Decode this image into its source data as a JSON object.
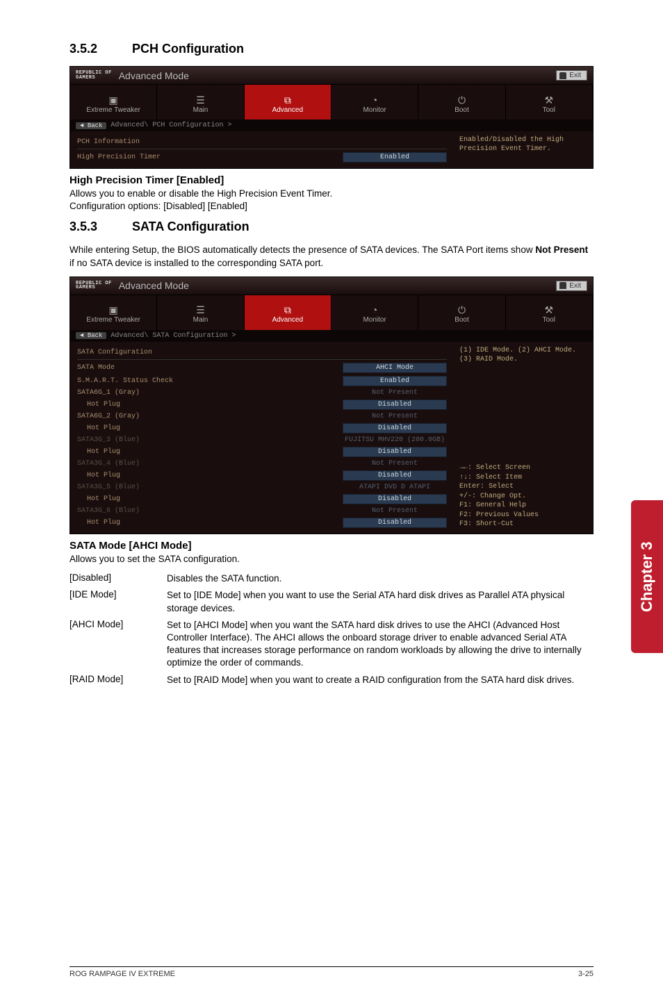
{
  "section_352": {
    "num": "3.5.2",
    "title": "PCH Configuration"
  },
  "bios1": {
    "brand_top": "REPUBLIC OF",
    "brand_bottom": "GAMERS",
    "mode": "Advanced Mode",
    "exit": "Exit",
    "tabs": [
      "Extreme Tweaker",
      "Main",
      "Advanced",
      "Monitor",
      "Boot",
      "Tool"
    ],
    "back": "Back",
    "breadcrumb": "Advanced\\ PCH Configuration >",
    "info_label": "PCH Information",
    "row_label": "High Precision Timer",
    "row_value": "Enabled",
    "help": "Enabled/Disabled the High Precision Event Timer."
  },
  "hpt": {
    "heading": "High Precision Timer [Enabled]",
    "line1": "Allows you to enable or disable the High Precision Event Timer.",
    "line2": "Configuration options: [Disabled] [Enabled]"
  },
  "section_353": {
    "num": "3.5.3",
    "title": "SATA Configuration"
  },
  "sata_intro": "While entering Setup, the BIOS automatically detects the presence of SATA devices. The SATA Port items show Not Present if no SATA device is installed to the corresponding SATA port.",
  "sata_intro_prefix": "While entering Setup, the BIOS automatically detects the presence of SATA devices. The SATA Port items show ",
  "sata_intro_bold": "Not Present",
  "sata_intro_suffix": " if no SATA device is installed to the corresponding SATA port.",
  "bios2": {
    "brand_top": "REPUBLIC OF",
    "brand_bottom": "GAMERS",
    "mode": "Advanced Mode",
    "exit": "Exit",
    "tabs": [
      "Extreme Tweaker",
      "Main",
      "Advanced",
      "Monitor",
      "Boot",
      "Tool"
    ],
    "back": "Back",
    "breadcrumb": "Advanced\\ SATA Configuration >",
    "section_label": "SATA Configuration",
    "rows": [
      {
        "label": "SATA Mode",
        "value": "AHCI Mode",
        "box": true
      },
      {
        "label": "S.M.A.R.T. Status Check",
        "value": "Enabled",
        "box": true
      },
      {
        "label": "SATA6G_1 (Gray)",
        "value": "Not Present",
        "box": false,
        "dimValue": true
      },
      {
        "label": "Hot Plug",
        "value": "Disabled",
        "box": true,
        "indent": true
      },
      {
        "label": "SATA6G_2 (Gray)",
        "value": "Not Present",
        "box": false,
        "dimValue": true
      },
      {
        "label": "Hot Plug",
        "value": "Disabled",
        "box": true,
        "indent": true
      },
      {
        "label": "SATA3G_3 (Blue)",
        "value": "FUJITSU MHV220 (200.0GB)",
        "box": false,
        "dimLabel": true,
        "dimValue": true
      },
      {
        "label": "Hot Plug",
        "value": "Disabled",
        "box": true,
        "indent": true
      },
      {
        "label": "SATA3G_4 (Blue)",
        "value": "Not Present",
        "box": false,
        "dimLabel": true,
        "dimValue": true
      },
      {
        "label": "Hot Plug",
        "value": "Disabled",
        "box": true,
        "indent": true
      },
      {
        "label": "SATA3G_5 (Blue)",
        "value": "ATAPI  DVD D  ATAPI",
        "box": false,
        "dimLabel": true,
        "dimValue": true
      },
      {
        "label": "Hot Plug",
        "value": "Disabled",
        "box": true,
        "indent": true
      },
      {
        "label": "SATA3G_6 (Blue)",
        "value": "Not Present",
        "box": false,
        "dimLabel": true,
        "dimValue": true
      },
      {
        "label": "Hot Plug",
        "value": "Disabled",
        "box": true,
        "indent": true
      }
    ],
    "help_top": "(1) IDE Mode. (2) AHCI Mode. (3) RAID Mode.",
    "help_lines": [
      "→←: Select Screen",
      "↑↓: Select Item",
      "Enter: Select",
      "+/-: Change Opt.",
      "F1: General Help",
      "F2: Previous Values",
      "F3: Short-Cut"
    ]
  },
  "satamode": {
    "heading": "SATA Mode [AHCI Mode]",
    "intro": "Allows you to set the SATA configuration.",
    "opts": [
      {
        "k": "[Disabled]",
        "v": "Disables the SATA function."
      },
      {
        "k": "[IDE Mode]",
        "v": "Set to [IDE Mode] when you want to use the Serial ATA hard disk drives as Parallel ATA physical storage devices."
      },
      {
        "k": "[AHCI Mode]",
        "v": "Set to [AHCI Mode] when you want the SATA hard disk drives to use the AHCI (Advanced Host Controller Interface). The AHCI allows the onboard storage driver to enable advanced Serial ATA features that increases storage performance on random workloads by allowing the drive to internally optimize the order of commands."
      },
      {
        "k": "[RAID Mode]",
        "v": "Set to [RAID Mode] when you want to create a RAID configuration from the SATA hard disk drives."
      }
    ]
  },
  "side_tab": "Chapter 3",
  "footer_left": "ROG RAMPAGE IV EXTREME",
  "footer_right": "3-25"
}
